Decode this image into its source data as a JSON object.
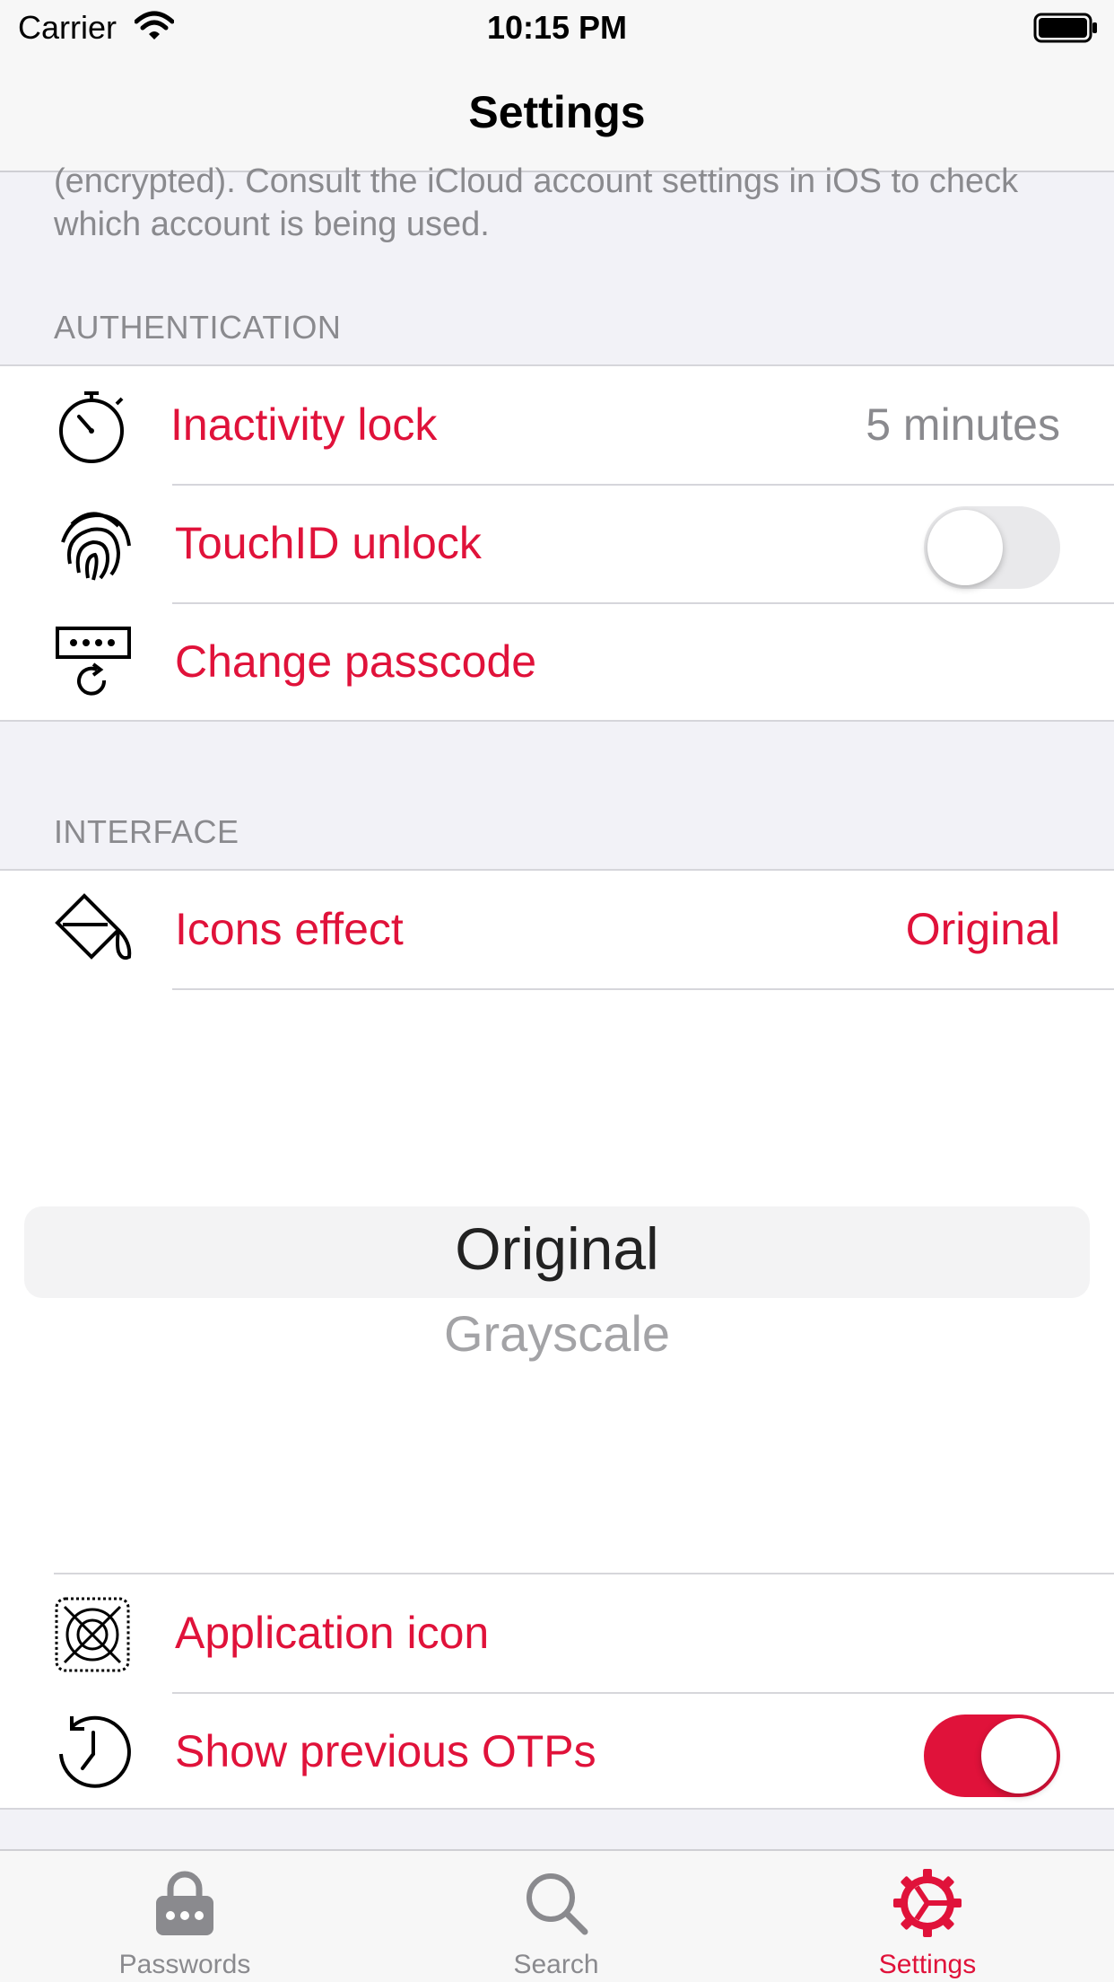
{
  "status_bar": {
    "carrier": "Carrier",
    "time": "10:15 PM"
  },
  "nav": {
    "title": "Settings"
  },
  "footer_text": "(encrypted). Consult the iCloud account settings in iOS to check which account is being used.",
  "sections": {
    "authentication": {
      "header": "AUTHENTICATION",
      "rows": [
        {
          "label": "Inactivity lock",
          "value": "5 minutes",
          "icon": "stopwatch-icon"
        },
        {
          "label": "TouchID unlock",
          "toggle": false,
          "icon": "fingerprint-icon"
        },
        {
          "label": "Change passcode",
          "icon": "passcode-icon"
        }
      ]
    },
    "interface": {
      "header": "INTERFACE",
      "rows": [
        {
          "label": "Icons effect",
          "value": "Original",
          "icon": "paint-bucket-icon"
        },
        {
          "label": "Application icon",
          "icon": "app-icon-placeholder-icon"
        },
        {
          "label": "Show previous OTPs",
          "toggle": true,
          "icon": "history-clock-icon"
        }
      ]
    }
  },
  "picker": {
    "selected": "Original",
    "options": [
      "Original",
      "Grayscale"
    ]
  },
  "tabbar": {
    "tabs": [
      {
        "label": "Passwords",
        "icon": "lock-icon",
        "active": false
      },
      {
        "label": "Search",
        "icon": "search-icon",
        "active": false
      },
      {
        "label": "Settings",
        "icon": "gear-icon",
        "active": true
      }
    ]
  },
  "colors": {
    "accent": "#e0123a",
    "secondary_text": "#8a8a8e",
    "group_background": "#f2f2f7"
  }
}
